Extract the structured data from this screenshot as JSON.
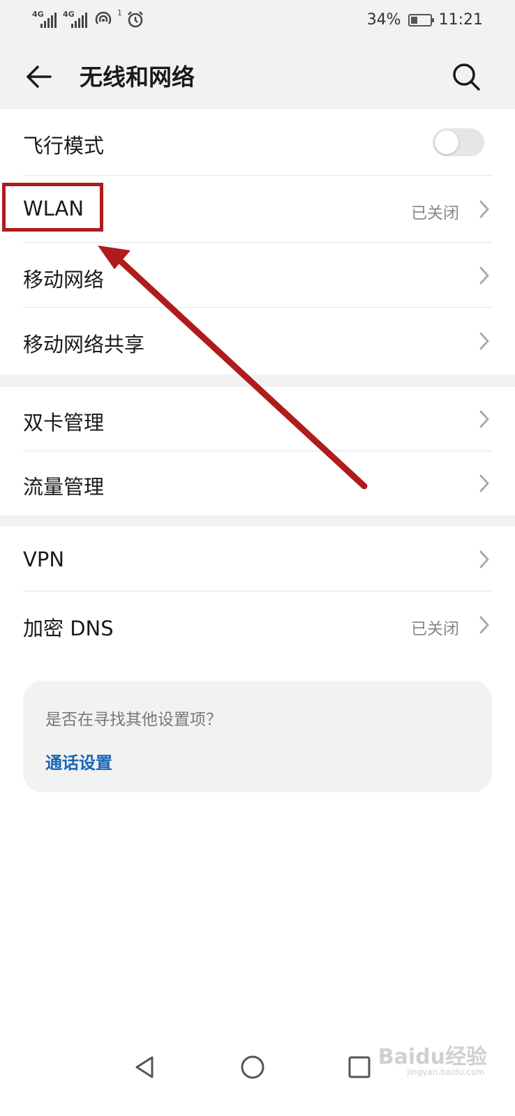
{
  "status_bar": {
    "signal1_tag": "4G",
    "signal2_tag": "4G",
    "alarm_badge": "1",
    "battery_percent_text": "34%",
    "battery_level": 0.34,
    "time": "11:21"
  },
  "header": {
    "back_icon": "arrow-left-icon",
    "title": "无线和网络",
    "search_icon": "search-icon"
  },
  "sections": [
    {
      "items": [
        {
          "label": "飞行模式",
          "control": "toggle",
          "toggle_on": false
        },
        {
          "label": "WLAN",
          "value": "已关闭",
          "control": "chevron"
        },
        {
          "label": "移动网络",
          "control": "chevron"
        },
        {
          "label": "移动网络共享",
          "control": "chevron"
        }
      ]
    },
    {
      "items": [
        {
          "label": "双卡管理",
          "control": "chevron"
        },
        {
          "label": "流量管理",
          "control": "chevron"
        }
      ]
    },
    {
      "items": [
        {
          "label": "VPN",
          "control": "chevron"
        },
        {
          "label": "加密 DNS",
          "value": "已关闭",
          "control": "chevron"
        }
      ]
    }
  ],
  "hint_card": {
    "question": "是否在寻找其他设置项？",
    "link_label": "通话设置"
  },
  "annotation": {
    "highlight_color": "#b01b1b",
    "arrow_color": "#b01b1b"
  },
  "nav_bar": {
    "back_icon": "triangle-back-icon",
    "home_icon": "circle-home-icon",
    "recents_icon": "square-recents-icon"
  },
  "watermark": {
    "brand": "Baidu经验",
    "sub": "jingyan.baidu.com"
  },
  "colors": {
    "link": "#1767b8",
    "secondary_text": "#888888",
    "background_gray": "#f2f2f2"
  }
}
